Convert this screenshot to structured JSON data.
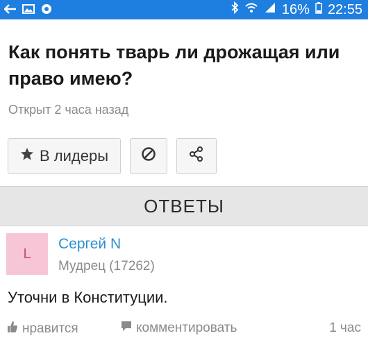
{
  "status_bar": {
    "battery_percent": "16%",
    "time": "22:55",
    "icons": [
      "back-icon",
      "image-icon",
      "shield-icon",
      "bluetooth-icon",
      "wifi-icon",
      "signal-icon",
      "battery-icon"
    ]
  },
  "question": {
    "title": "Как понять тварь ли дрожащая или право имею?",
    "opened": "Открыт 2 часа назад"
  },
  "actions": {
    "leader_label": "В лидеры"
  },
  "answers": {
    "header": "ОТВЕТЫ",
    "items": [
      {
        "avatar_letter": "L",
        "author": "Сергей N",
        "rank": "Мудрец (17262)",
        "text": "Уточни в Конституции.",
        "like_label": "нравится",
        "comment_label": "комментировать",
        "time": "1 час"
      }
    ]
  },
  "colors": {
    "status_bar": "#1f7fe0",
    "link": "#2a8fd0",
    "avatar_bg": "#f6c6d6"
  }
}
